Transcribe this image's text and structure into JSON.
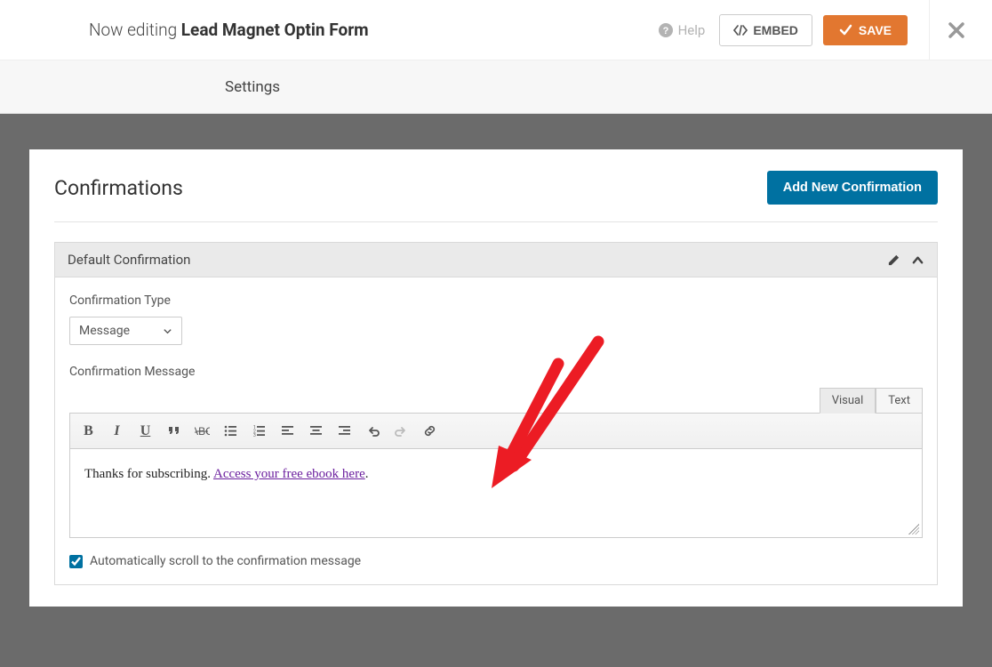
{
  "header": {
    "editing_prefix": "Now editing",
    "form_name": "Lead Magnet Optin Form",
    "help": "Help",
    "embed": "EMBED",
    "save": "SAVE"
  },
  "tabs": {
    "settings": "Settings"
  },
  "panel": {
    "title": "Confirmations",
    "add_button": "Add New Confirmation"
  },
  "confirmation": {
    "name": "Default Confirmation",
    "type_label": "Confirmation Type",
    "type_value": "Message",
    "message_label": "Confirmation Message",
    "editor_tabs": {
      "visual": "Visual",
      "text": "Text"
    },
    "message_text_before": "Thanks for subscribing. ",
    "message_link_text": "Access your free ebook here",
    "message_text_after": ".",
    "autoscroll_label": "Automatically scroll to the confirmation message",
    "autoscroll_checked": true
  }
}
